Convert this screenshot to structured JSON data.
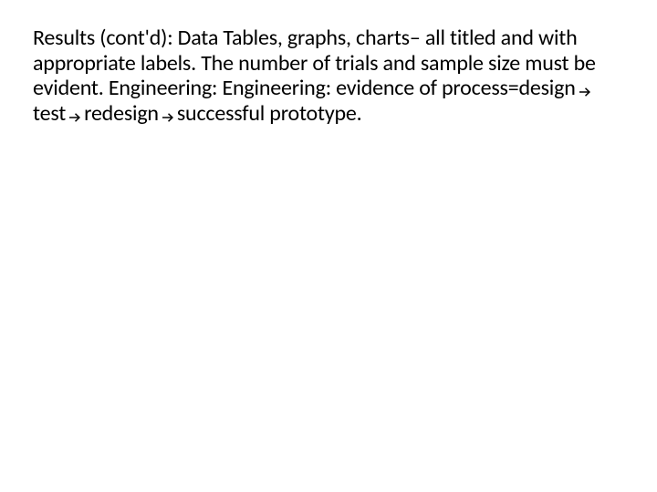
{
  "paragraph": {
    "seg1": "Results (cont'd):  Data Tables, graphs, charts– all titled and with appropriate labels. The number of trials and sample size must be evident. Engineering: Engineering:  evidence of process=design",
    "seg2": "test",
    "seg3": "redesign",
    "seg4": "successful prototype."
  }
}
